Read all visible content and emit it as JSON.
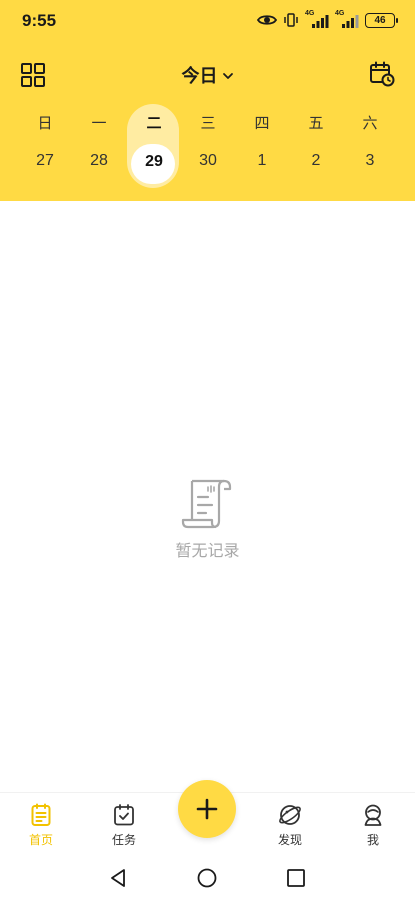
{
  "status_bar": {
    "time": "9:55",
    "network_1": "4G",
    "network_2": "4G",
    "battery": "46"
  },
  "header": {
    "title": "今日",
    "left_icon": "grid-icon",
    "right_icon": "calendar-clock-icon",
    "accent_color": "#FFDA44"
  },
  "week": {
    "days": [
      {
        "weekday": "日",
        "date": "27"
      },
      {
        "weekday": "一",
        "date": "28"
      },
      {
        "weekday": "二",
        "date": "29"
      },
      {
        "weekday": "三",
        "date": "30"
      },
      {
        "weekday": "四",
        "date": "1"
      },
      {
        "weekday": "五",
        "date": "2"
      },
      {
        "weekday": "六",
        "date": "3"
      }
    ],
    "selected_index": 2
  },
  "empty_state": {
    "icon": "scroll-document-icon",
    "text": "暂无记录"
  },
  "tabbar": {
    "items": [
      {
        "label": "首页",
        "icon": "notes-icon",
        "active": true
      },
      {
        "label": "任务",
        "icon": "calendar-check-icon",
        "active": false
      },
      {
        "label": "发现",
        "icon": "planet-icon",
        "active": false
      },
      {
        "label": "我",
        "icon": "user-icon",
        "active": false
      }
    ],
    "fab_icon": "plus-icon",
    "active_color": "#F2C200"
  },
  "system_nav": [
    "back-icon",
    "home-icon",
    "recents-icon"
  ]
}
